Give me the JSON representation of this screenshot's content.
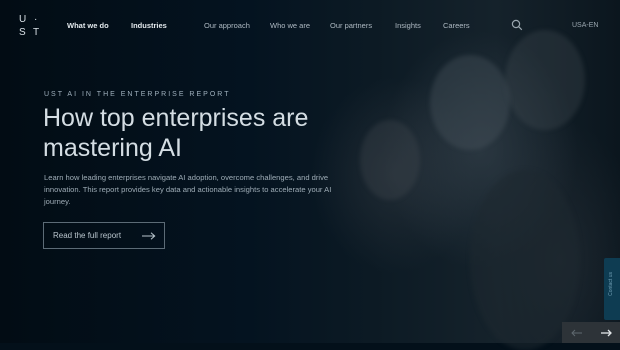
{
  "brand": {
    "logo_letters": [
      "U",
      "S",
      "T"
    ]
  },
  "nav": {
    "items": [
      {
        "label": "What we do",
        "bold": true
      },
      {
        "label": "Industries",
        "bold": true
      },
      {
        "label": "Our approach",
        "bold": false
      },
      {
        "label": "Who we are",
        "bold": false
      },
      {
        "label": "Our partners",
        "bold": false
      },
      {
        "label": "Insights",
        "bold": false
      },
      {
        "label": "Careers",
        "bold": false
      }
    ],
    "language": "USA-EN"
  },
  "hero": {
    "eyebrow": "UST AI IN THE ENTERPRISE REPORT",
    "headline": "How top enterprises are mastering AI",
    "body": "Learn how leading enterprises navigate AI adoption, overcome challenges, and drive innovation. This report provides key data and actionable insights to accelerate your AI journey.",
    "cta_label": "Read the full report"
  },
  "side_tab_label": "Contact us",
  "icons": {
    "search": "search-icon",
    "cta_arrow": "arrow-right-icon",
    "prev": "arrow-left-icon",
    "next": "arrow-right-icon"
  },
  "colors": {
    "background": "#03101a",
    "side_tab": "#0e3c52",
    "carousel_nav": "#2d3338"
  }
}
